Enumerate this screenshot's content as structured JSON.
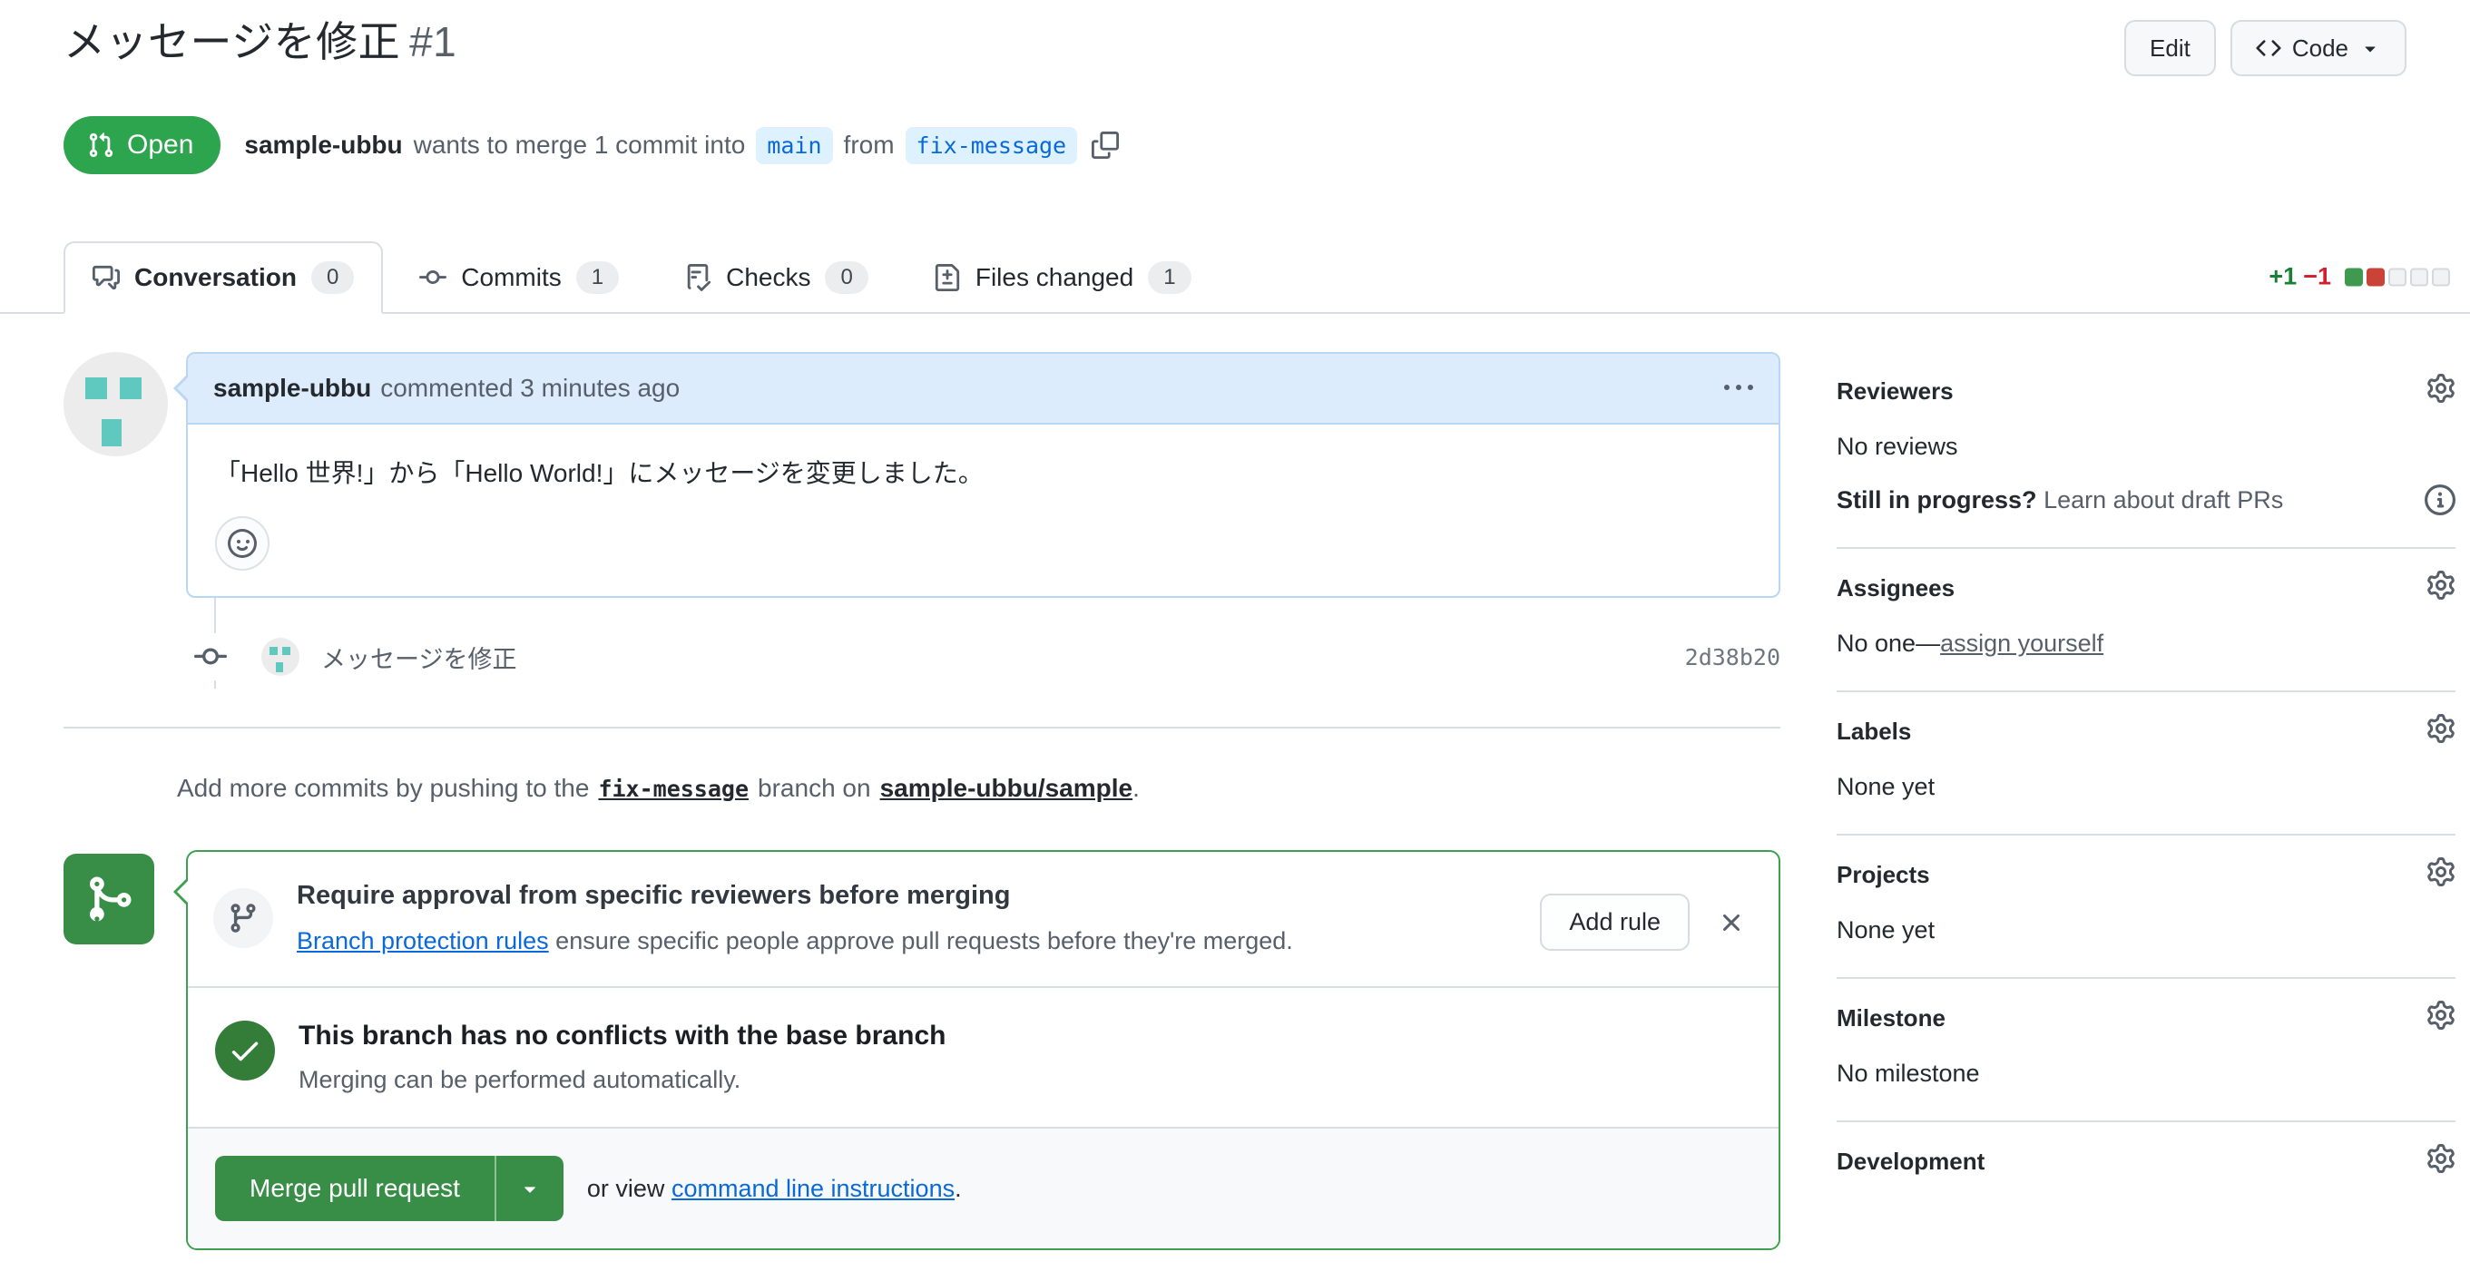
{
  "header": {
    "title": "メッセージを修正",
    "number": "#1",
    "edit_button": "Edit",
    "code_button": "Code",
    "state_badge": "Open",
    "author": "sample-ubbu",
    "merge_text_1": "wants to merge 1 commit into",
    "base_branch": "main",
    "merge_text_2": "from",
    "head_branch": "fix-message"
  },
  "tabs": [
    {
      "label": "Conversation",
      "count": "0",
      "active": true
    },
    {
      "label": "Commits",
      "count": "1",
      "active": false
    },
    {
      "label": "Checks",
      "count": "0",
      "active": false
    },
    {
      "label": "Files changed",
      "count": "1",
      "active": false
    }
  ],
  "diffstat": {
    "additions": "+1",
    "deletions": "−1",
    "blocks": [
      "green",
      "red",
      "neutral",
      "neutral",
      "neutral"
    ]
  },
  "comment": {
    "author": "sample-ubbu",
    "meta": "commented 3 minutes ago",
    "body": "「Hello 世界!」から「Hello World!」にメッセージを変更しました。"
  },
  "commit": {
    "message": "メッセージを修正",
    "sha": "2d38b20"
  },
  "push_note": {
    "pre": "Add more commits by pushing to the",
    "branch": "fix-message",
    "mid": "branch on",
    "repo": "sample-ubbu/sample",
    "post": "."
  },
  "merge_box": {
    "rule_title": "Require approval from specific reviewers before merging",
    "rule_link": "Branch protection rules",
    "rule_desc": "ensure specific people approve pull requests before they're merged.",
    "add_rule_button": "Add rule",
    "conflict_title": "This branch has no conflicts with the base branch",
    "conflict_desc": "Merging can be performed automatically.",
    "merge_button": "Merge pull request",
    "or_view": "or view",
    "cli_link": "command line instructions",
    "period": "."
  },
  "sidebar": {
    "reviewers": {
      "title": "Reviewers",
      "empty": "No reviews",
      "progress_strong": "Still in progress?",
      "progress_link": "Learn about draft PRs"
    },
    "assignees": {
      "title": "Assignees",
      "empty": "No one—",
      "self_assign": "assign yourself"
    },
    "labels": {
      "title": "Labels",
      "empty": "None yet"
    },
    "projects": {
      "title": "Projects",
      "empty": "None yet"
    },
    "milestone": {
      "title": "Milestone",
      "empty": "No milestone"
    },
    "development": {
      "title": "Development"
    }
  },
  "colors": {
    "open_green": "#2da44e",
    "merge_green": "#388e46",
    "addition_green": "#1a7f37",
    "deletion_red": "#cf222e",
    "link_blue": "#0969da",
    "branch_chip_bg": "#ddf1ff",
    "comment_header_bg": "#dcecfc",
    "muted_gray": "#57606a"
  }
}
